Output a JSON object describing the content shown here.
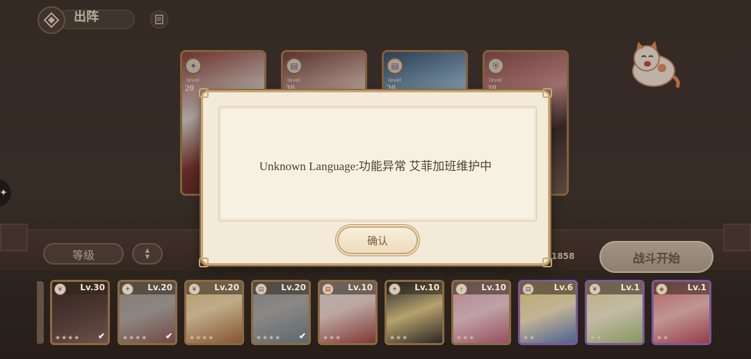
{
  "header": {
    "title": "出阵"
  },
  "team": [
    {
      "class_icon": "mage-icon",
      "level_caption": "level",
      "level": "20"
    },
    {
      "class_icon": "book-icon",
      "level_caption": "level",
      "level": "30"
    },
    {
      "class_icon": "book-icon",
      "level_caption": "level",
      "level": "20"
    },
    {
      "class_icon": "shield-icon",
      "level_caption": "level",
      "level": "30"
    }
  ],
  "controls": {
    "sort_label": "等级",
    "sort_toggle_icon": "sort-up-down-icon",
    "power_text": "战力: 1858",
    "battle_label": "战斗开始"
  },
  "roster": [
    {
      "level": "Lv.30",
      "class_icon": "leaf-icon",
      "rarity": "gold",
      "selected": true
    },
    {
      "level": "Lv.20",
      "class_icon": "mage-icon",
      "rarity": "gold",
      "selected": true
    },
    {
      "level": "Lv.20",
      "class_icon": "leaf-icon",
      "rarity": "gold",
      "selected": false
    },
    {
      "level": "Lv.20",
      "class_icon": "book-icon",
      "rarity": "gold",
      "selected": true
    },
    {
      "level": "Lv.10",
      "class_icon": "book-icon",
      "rarity": "gold",
      "selected": false
    },
    {
      "level": "Lv.10",
      "class_icon": "mage-icon",
      "rarity": "gold",
      "selected": false
    },
    {
      "level": "Lv.10",
      "class_icon": "sword-icon",
      "rarity": "gold",
      "selected": false
    },
    {
      "level": "Lv.6",
      "class_icon": "book-icon",
      "rarity": "purple",
      "selected": false
    },
    {
      "level": "Lv.1",
      "class_icon": "leaf-icon",
      "rarity": "purple",
      "selected": false
    },
    {
      "level": "Lv.1",
      "class_icon": "gem-icon",
      "rarity": "purple",
      "selected": false
    }
  ],
  "dialog": {
    "message": "Unknown Language:功能异常 艾菲加班维护中",
    "confirm_label": "确认"
  },
  "colors": {
    "frame_gold": "#c9a774",
    "dialog_bg": "#f4ead8",
    "rare_purple": "#9c6ec4"
  }
}
